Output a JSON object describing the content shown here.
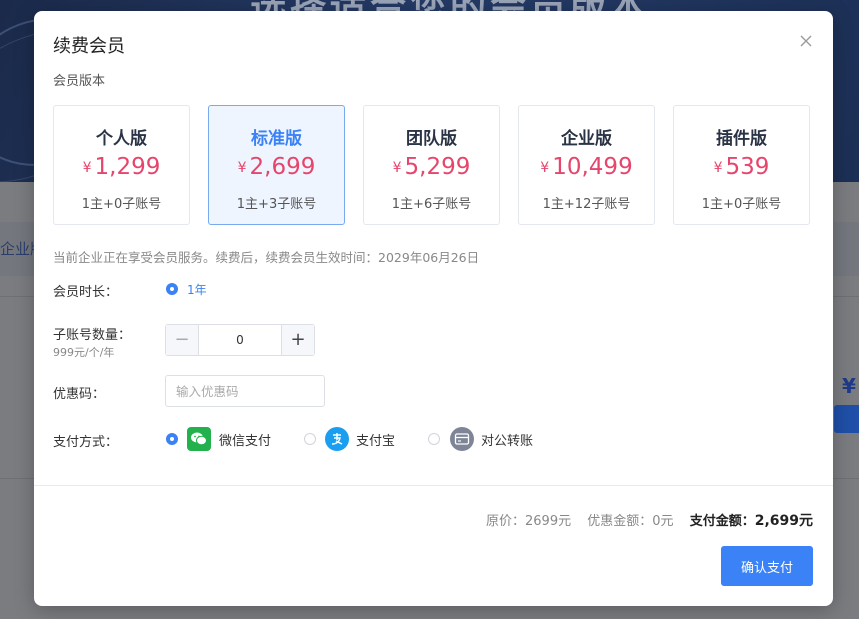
{
  "background": {
    "banner_title": "选择适合您的会员版本",
    "tab_fragment": "企业版",
    "price_fragment": "¥"
  },
  "modal": {
    "title": "续费会员",
    "section_label": "会员版本",
    "plans": [
      {
        "name": "个人版",
        "currency": "¥",
        "price": "1,299",
        "accounts": "1主+0子账号",
        "selected": false
      },
      {
        "name": "标准版",
        "currency": "¥",
        "price": "2,699",
        "accounts": "1主+3子账号",
        "selected": true
      },
      {
        "name": "团队版",
        "currency": "¥",
        "price": "5,299",
        "accounts": "1主+6子账号",
        "selected": false
      },
      {
        "name": "企业版",
        "currency": "¥",
        "price": "10,499",
        "accounts": "1主+12子账号",
        "selected": false
      },
      {
        "name": "插件版",
        "currency": "¥",
        "price": "539",
        "accounts": "1主+0子账号",
        "selected": false
      }
    ],
    "notice": "当前企业正在享受会员服务。续费后，续费会员生效时间：2029年06月26日",
    "duration": {
      "label": "会员时长：",
      "option": "1年"
    },
    "subaccounts": {
      "label": "子账号数量：",
      "sublabel": "999元/个/年",
      "value": "0",
      "minus": "−",
      "plus": "+"
    },
    "coupon": {
      "label": "优惠码：",
      "placeholder": "输入优惠码",
      "value": ""
    },
    "payment": {
      "label": "支付方式：",
      "options": [
        {
          "label": "微信支付",
          "icon": "wechat-icon",
          "color": "#22b14c",
          "checked": true
        },
        {
          "label": "支付宝",
          "icon": "alipay-icon",
          "color": "#1b9df0",
          "checked": false
        },
        {
          "label": "对公转账",
          "icon": "bank-card-icon",
          "color": "#7d8596",
          "checked": false
        }
      ]
    },
    "summary": {
      "original_label": "原价：",
      "original_value": "2699元",
      "discount_label": "优惠金额：",
      "discount_value": "0元",
      "total_label": "支付金额：",
      "total_value": "2,699元"
    },
    "confirm_label": "确认支付"
  },
  "colors": {
    "accent": "#3b82f6",
    "price": "#e6456c"
  }
}
